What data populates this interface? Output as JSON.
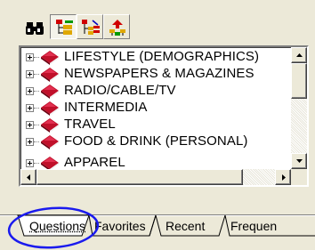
{
  "toolbar": {
    "buttons": [
      {
        "icon": "binoculars-icon"
      },
      {
        "icon": "tree-view-icon"
      },
      {
        "icon": "tree-remove-icon"
      },
      {
        "icon": "tree-up-icon"
      }
    ]
  },
  "tree": {
    "items": [
      {
        "label": "LIFESTYLE (DEMOGRAPHICS)"
      },
      {
        "label": "NEWSPAPERS & MAGAZINES"
      },
      {
        "label": "RADIO/CABLE/TV"
      },
      {
        "label": "INTERMEDIA"
      },
      {
        "label": "TRAVEL"
      },
      {
        "label": "FOOD & DRINK (PERSONAL)"
      },
      {
        "label": "APPAREL"
      }
    ]
  },
  "tabs": [
    {
      "label": "Questions",
      "active": true
    },
    {
      "label": "Favorites",
      "active": false
    },
    {
      "label": "Recent",
      "active": false
    },
    {
      "label": "Frequen",
      "active": false
    }
  ],
  "colors": {
    "annotation_circle": "#1a1aee",
    "book_red": "#c0102a",
    "window_bg": "#ece9d8"
  }
}
